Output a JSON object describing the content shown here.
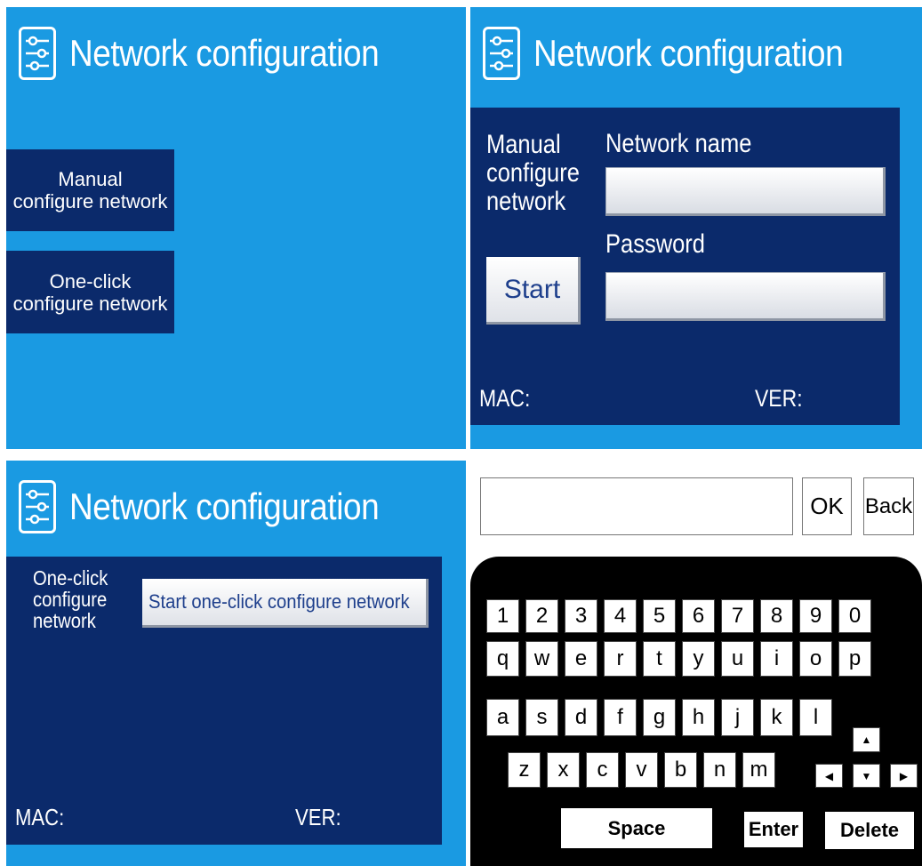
{
  "colors": {
    "panel_bg": "#1a9ae2",
    "navy": "#0b2a6b",
    "keyboard_bg": "#000000"
  },
  "header": {
    "title": "Network configuration",
    "icon": "settings-sliders-icon"
  },
  "panel1": {
    "manual_button": [
      "Manual",
      "configure network"
    ],
    "oneclick_button": [
      "One-click",
      "configure network"
    ]
  },
  "panel2": {
    "side_label": [
      "Manual",
      "configure",
      "network"
    ],
    "network_name_label": "Network name",
    "password_label": "Password",
    "start_button": "Start",
    "mac_label": "MAC:",
    "ver_label": "VER:"
  },
  "panel3": {
    "side_label": [
      "One-click",
      "configure",
      "network"
    ],
    "start_button": "Start one-click configure network",
    "mac_label": "MAC:",
    "ver_label": "VER:"
  },
  "panel4": {
    "ok_button": "OK",
    "back_button": "Back",
    "row1": [
      "1",
      "2",
      "3",
      "4",
      "5",
      "6",
      "7",
      "8",
      "9",
      "0"
    ],
    "row2": [
      "q",
      "w",
      "e",
      "r",
      "t",
      "y",
      "u",
      "i",
      "o",
      "p"
    ],
    "row3": [
      "a",
      "s",
      "d",
      "f",
      "g",
      "h",
      "j",
      "k",
      "l"
    ],
    "row4": [
      "z",
      "x",
      "c",
      "v",
      "b",
      "n",
      "m"
    ],
    "arrows": {
      "up": "▲",
      "left": "◀",
      "down": "▼",
      "right": "▶"
    },
    "space_key": "Space",
    "enter_key": "Enter",
    "delete_key": "Delete"
  }
}
